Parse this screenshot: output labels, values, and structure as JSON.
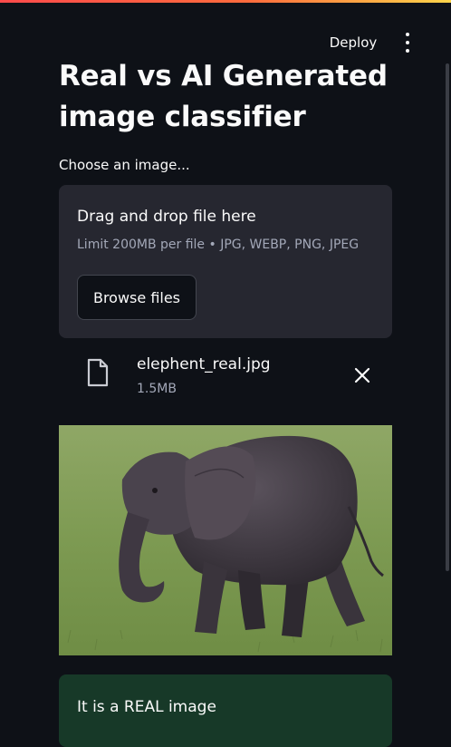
{
  "header": {
    "deploy_label": "Deploy",
    "menu_icon": "kebab-menu-icon"
  },
  "main": {
    "title": "Real vs AI Generated image classifier",
    "uploader": {
      "label": "Choose an image...",
      "dropzone_title": "Drag and drop file here",
      "dropzone_limit": "Limit 200MB per file • JPG, WEBP, PNG, JPEG",
      "browse_label": "Browse files"
    },
    "uploaded_file": {
      "name": "elephent_real.jpg",
      "size": "1.5MB",
      "icon": "file-icon",
      "remove_icon": "close-icon"
    },
    "image": {
      "subject": "elephant",
      "icon": "photo"
    },
    "result": {
      "text": "It is a REAL image"
    }
  },
  "colors": {
    "background": "#0e1117",
    "panel": "#262730",
    "success": "#173928",
    "accent_gradient_start": "#ff4b4b",
    "accent_gradient_end": "#ffd54a"
  }
}
